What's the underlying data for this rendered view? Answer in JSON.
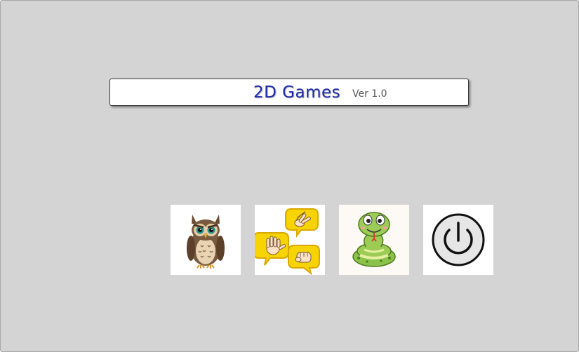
{
  "header": {
    "title": "2D Games",
    "version": "Ver 1.0"
  },
  "launcher": {
    "buttons": [
      {
        "id": "owl",
        "icon": "owl-icon"
      },
      {
        "id": "rock-paper-scissors",
        "icon": "rock-paper-scissors-icon"
      },
      {
        "id": "snake",
        "icon": "snake-icon"
      },
      {
        "id": "power",
        "icon": "power-icon"
      }
    ]
  },
  "colors": {
    "background": "#d4d4d4",
    "title": "#1c2aa8",
    "version": "#555555"
  }
}
